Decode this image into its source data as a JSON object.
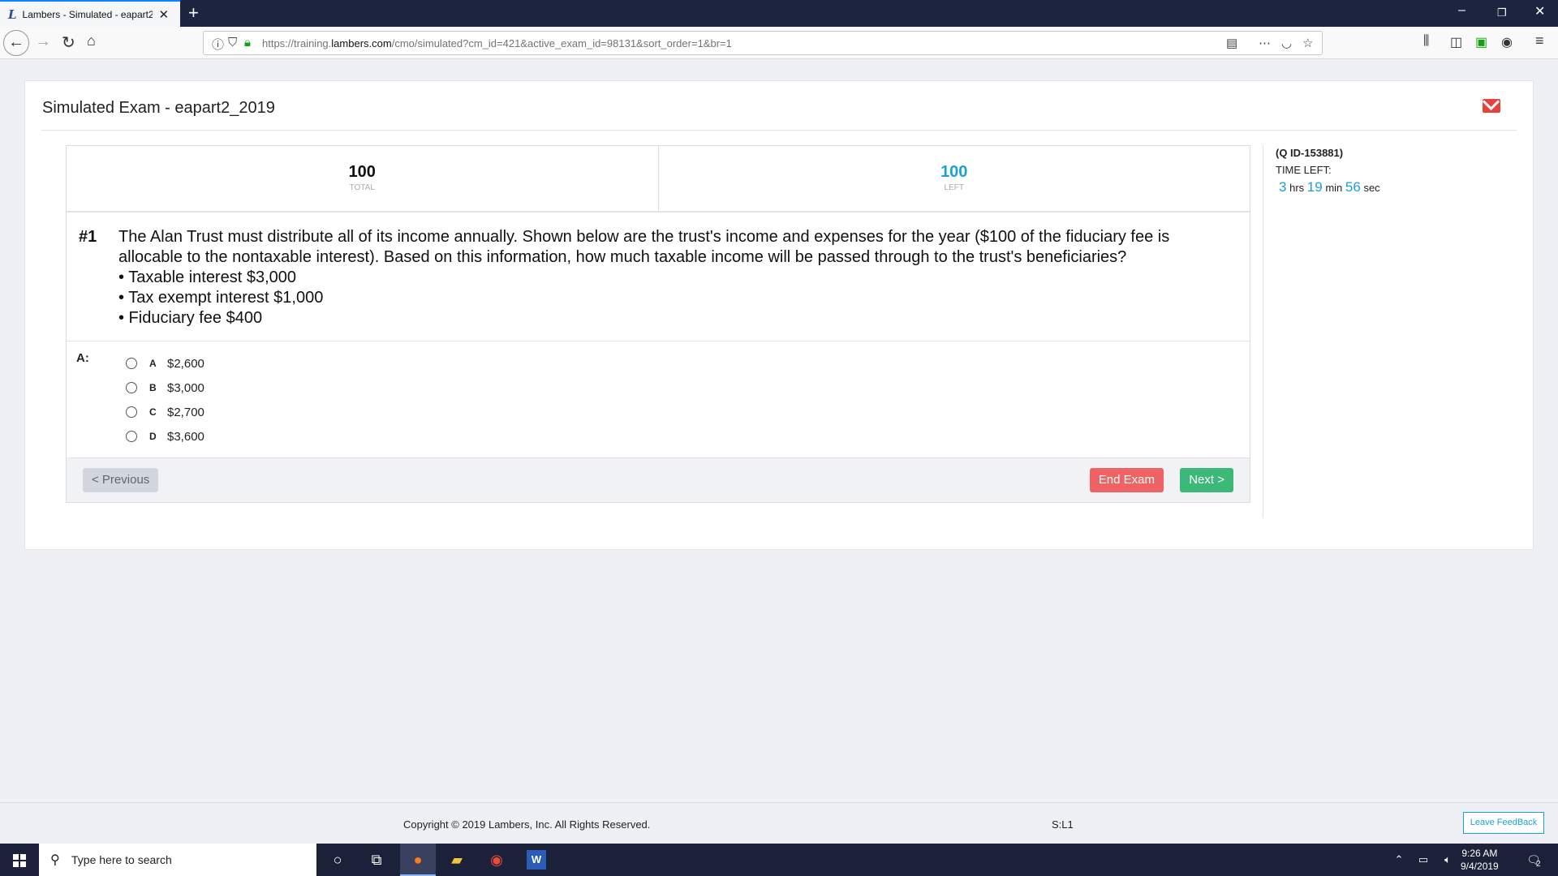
{
  "browser": {
    "tab_title": "Lambers - Simulated - eapart2_",
    "tab_logo": "L",
    "url_prefix": "https://training.",
    "url_domain": "lambers.com",
    "url_path": "/cmo/simulated?cm_id=421&active_exam_id=98131&sort_order=1&br=1"
  },
  "page": {
    "title": "Simulated Exam - eapart2_2019"
  },
  "stats": {
    "total_value": "100",
    "total_label": "TOTAL",
    "left_value": "100",
    "left_label": "LEFT"
  },
  "question": {
    "number": "#1",
    "text": "The Alan Trust must distribute all of its income annually. Shown below are the trust's income and expenses for the year ($100 of the fiduciary fee is allocable to the nontaxable interest). Based on this information, how much taxable income will be passed through to the trust's beneficiaries?",
    "bullets": [
      "• Taxable interest $3,000",
      "• Tax exempt interest $1,000",
      "• Fiduciary fee $400"
    ]
  },
  "answers": {
    "label": "A:",
    "options": [
      {
        "letter": "A",
        "text": "$2,600"
      },
      {
        "letter": "B",
        "text": "$3,000"
      },
      {
        "letter": "C",
        "text": "$2,700"
      },
      {
        "letter": "D",
        "text": "$3,600"
      }
    ]
  },
  "buttons": {
    "previous": "< Previous",
    "end_exam": "End Exam",
    "next": "Next >"
  },
  "sidebar": {
    "qid": "(Q ID-153881)",
    "time_left_label": "TIME LEFT:",
    "hrs": "3",
    "hrs_unit": "hrs",
    "min": "19",
    "min_unit": "min",
    "sec": "56",
    "sec_unit": "sec"
  },
  "footer": {
    "copyright": "Copyright © 2019 Lambers, Inc. All Rights Reserved.",
    "sl": "S:L1",
    "feedback": "Leave FeedBack"
  },
  "taskbar": {
    "search_placeholder": "Type here to search",
    "time": "9:26 AM",
    "date": "9/4/2019",
    "notifications": "2"
  },
  "colors": {
    "accent_blue": "#1ba1d4",
    "end_exam": "#f06364",
    "next": "#3cb878",
    "mail": "#e8403a"
  }
}
